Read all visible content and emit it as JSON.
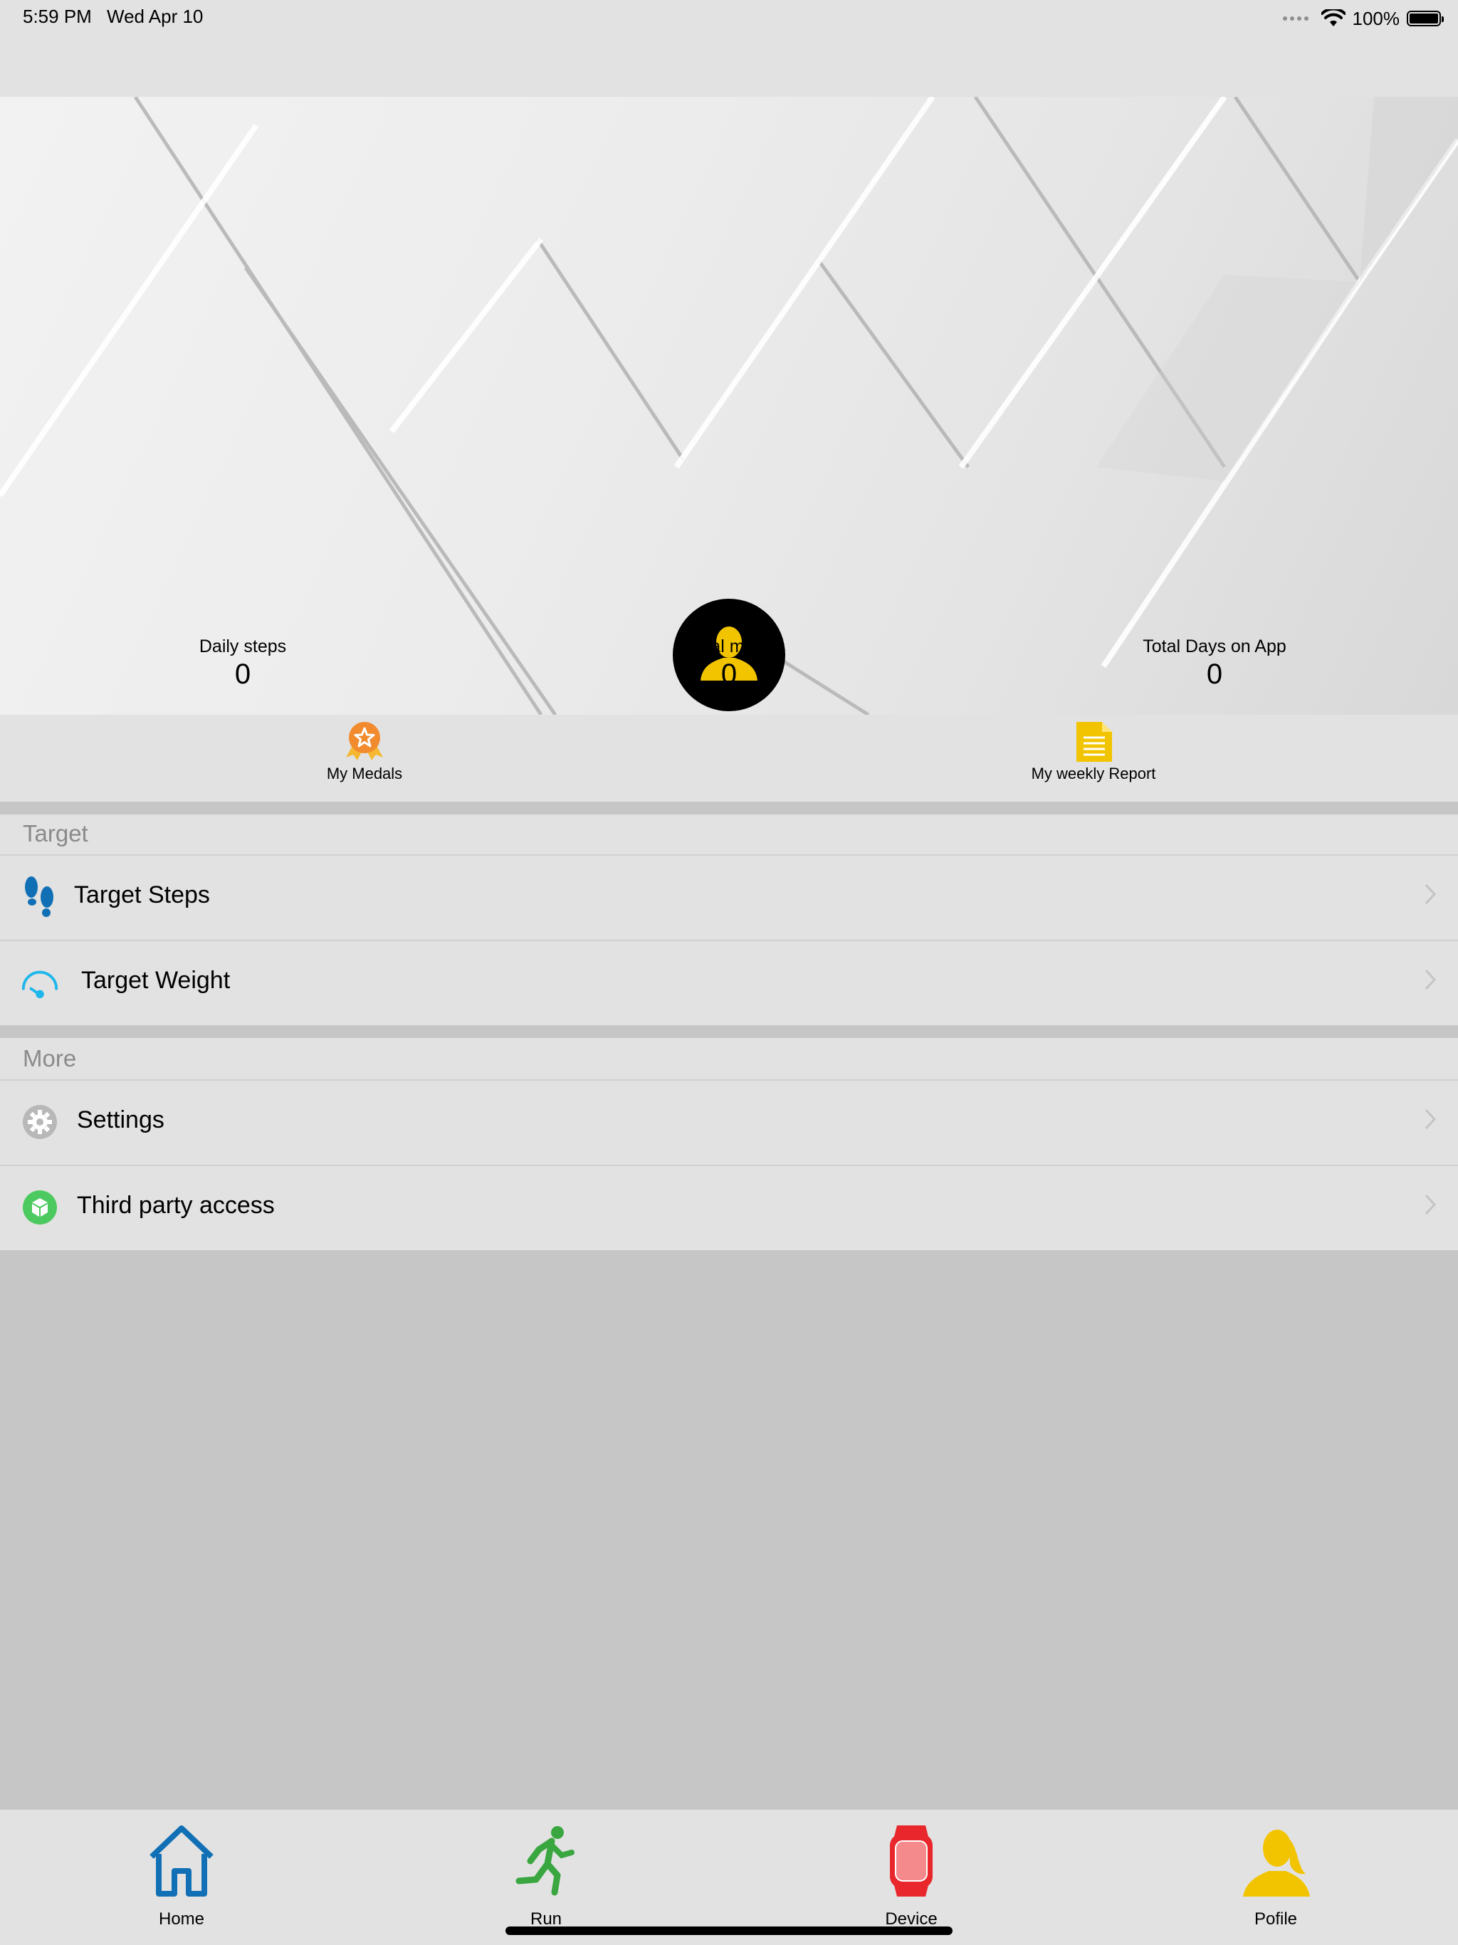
{
  "status": {
    "time": "5:59 PM",
    "date": "Wed Apr 10",
    "battery": "100%"
  },
  "stats": [
    {
      "label": "Daily steps",
      "value": "0"
    },
    {
      "label": "Total miles",
      "value": "0"
    },
    {
      "label": "Total Days on App",
      "value": "0"
    }
  ],
  "quick_actions": {
    "medals": "My Medals",
    "report": "My weekly Report"
  },
  "sections": {
    "target": {
      "title": "Target",
      "items": [
        "Target Steps",
        "Target Weight"
      ]
    },
    "more": {
      "title": "More",
      "items": [
        "Settings",
        "Third party access"
      ]
    }
  },
  "tabs": [
    {
      "label": "Home",
      "icon": "home-icon",
      "color": "#1170b5"
    },
    {
      "label": "Run",
      "icon": "run-icon",
      "color": "#3aa63f"
    },
    {
      "label": "Device",
      "icon": "watch-icon",
      "color": "#e8262c"
    },
    {
      "label": "Pofile",
      "icon": "profile-icon",
      "color": "#f2c400"
    }
  ],
  "colors": {
    "avatar_yellow": "#f2c400",
    "steps_blue": "#1170b5",
    "weight_cyan": "#1fb6ea",
    "settings_gray": "#b8b8b8",
    "third_party_green": "#4cc95f",
    "medal_orange": "#f28a2e"
  }
}
